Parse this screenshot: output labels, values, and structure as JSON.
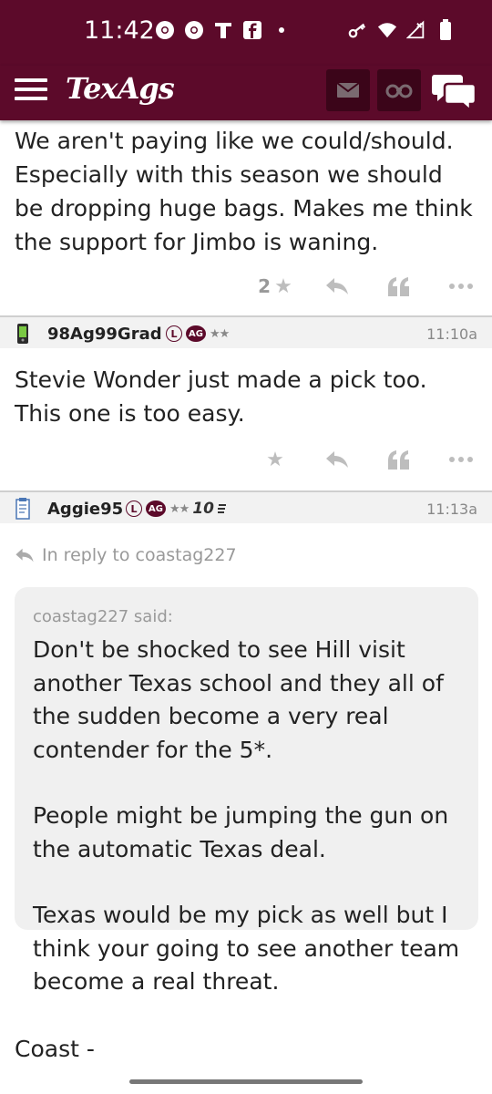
{
  "status_bar": {
    "time": "11:42",
    "left_icons": [
      "chrome-icon",
      "chrome-icon",
      "t-mobile-icon",
      "facebook-icon",
      "dot-icon"
    ],
    "right_icons": [
      "key-icon",
      "wifi-icon",
      "signal-icon",
      "battery-icon"
    ]
  },
  "header": {
    "logo": "TexAgs",
    "brand_color": "#5c0a2a"
  },
  "posts": [
    {
      "id": "post-top",
      "text": "We aren't paying like we could/should. Especially with this season we should be dropping huge bags. Makes me think the support for Jimbo is waning.",
      "star_count": "2"
    },
    {
      "id": "post-98ag99grad",
      "username": "98Ag99Grad",
      "badge_l": "L",
      "badge_ag": "AG",
      "stars": "★★",
      "time": "11:10a",
      "text": "Stevie Wonder just made a pick too. This one is too easy."
    },
    {
      "id": "post-aggie95",
      "username": "Aggie95",
      "badge_l": "L",
      "badge_ag": "AG",
      "stars": "★★",
      "ten_badge": "10",
      "time": "11:13a",
      "reply_to": "In reply to coastag227",
      "quote_author": "coastag227 said:",
      "quote_paragraphs": [
        "Don't be shocked to see Hill visit another Texas school and they all of the sudden become a very real contender for the 5*.",
        "People might be jumping the gun on the automatic Texas deal.",
        "Texas would be my pick as well but I think your going to see another team become a real threat."
      ],
      "text": "Coast -"
    }
  ]
}
